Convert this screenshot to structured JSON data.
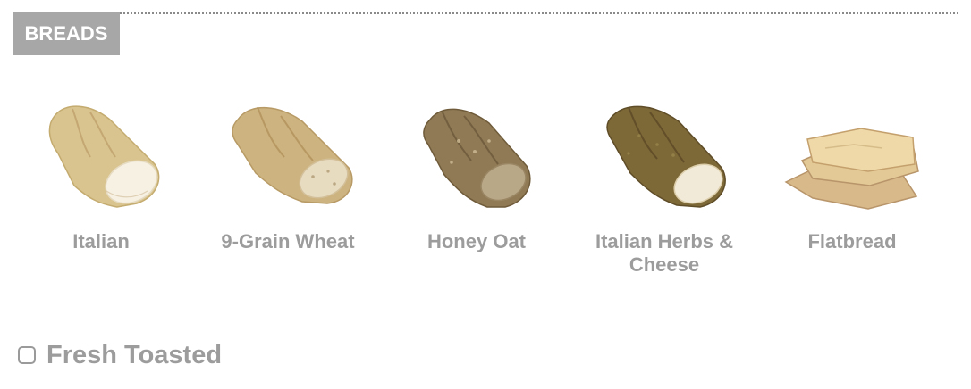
{
  "section": {
    "title": "BREADS"
  },
  "breads": [
    {
      "label": "Italian",
      "icon": "italian-bread-icon"
    },
    {
      "label": "9-Grain Wheat",
      "icon": "wheat-bread-icon"
    },
    {
      "label": "Honey Oat",
      "icon": "honey-oat-bread-icon"
    },
    {
      "label": "Italian Herbs & Cheese",
      "icon": "herbs-cheese-bread-icon"
    },
    {
      "label": "Flatbread",
      "icon": "flatbread-icon"
    }
  ],
  "options": {
    "toast_label": "Fresh Toasted",
    "toast_checked": false
  },
  "colors": {
    "tag_bg": "#a7a7a7",
    "label_text": "#9c9c9c",
    "italian": "#d9c48f",
    "wheat": "#cdb37f",
    "honey_oat": "#8f7a55",
    "herbs_cheese": "#7d6838",
    "flatbread": "#e0c58f"
  }
}
